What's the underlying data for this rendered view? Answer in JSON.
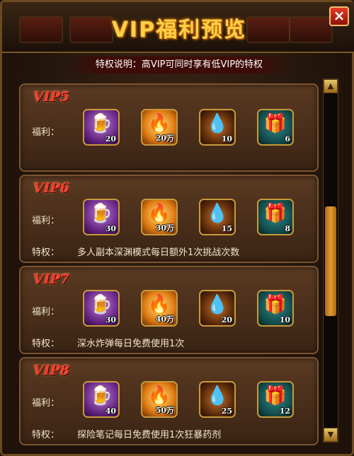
{
  "window": {
    "title": "VIP福利预览",
    "close_label": "×",
    "notice": "特权说明：高VIP可同时享有低VIP的特权"
  },
  "labels": {
    "benefit": "福利：",
    "privilege": "特权："
  },
  "scrollbar": {
    "up": "▲",
    "down": "▼"
  },
  "icons": {
    "beer": "beer-bread-icon",
    "fire": "fire-icon",
    "drop": "dark-drop-icon",
    "gift": "gift-box-icon"
  },
  "tiers": [
    {
      "name": "VIP5",
      "items": [
        {
          "icon": "beer-bread-icon",
          "count": "20"
        },
        {
          "icon": "fire-icon",
          "count": "20万"
        },
        {
          "icon": "dark-drop-icon",
          "count": "10"
        },
        {
          "icon": "gift-box-icon",
          "count": "6"
        }
      ],
      "privilege": ""
    },
    {
      "name": "VIP6",
      "items": [
        {
          "icon": "beer-bread-icon",
          "count": "30"
        },
        {
          "icon": "fire-icon",
          "count": "30万"
        },
        {
          "icon": "dark-drop-icon",
          "count": "15"
        },
        {
          "icon": "gift-box-icon",
          "count": "8"
        }
      ],
      "privilege": "多人副本深渊模式每日额外1次挑战次数"
    },
    {
      "name": "VIP7",
      "items": [
        {
          "icon": "beer-bread-icon",
          "count": "30"
        },
        {
          "icon": "fire-icon",
          "count": "40万"
        },
        {
          "icon": "dark-drop-icon",
          "count": "20"
        },
        {
          "icon": "gift-box-icon",
          "count": "10"
        }
      ],
      "privilege": "深水炸弹每日免费使用1次"
    },
    {
      "name": "VIP8",
      "items": [
        {
          "icon": "beer-bread-icon",
          "count": "40"
        },
        {
          "icon": "fire-icon",
          "count": "50万"
        },
        {
          "icon": "dark-drop-icon",
          "count": "25"
        },
        {
          "icon": "gift-box-icon",
          "count": "12"
        }
      ],
      "privilege": "探险笔记每日免费使用1次狂暴药剂"
    }
  ],
  "colors": {
    "title": "#ffcf4a",
    "vip_label": "#ff3b2b",
    "panel": "#4a2f1b",
    "border": "#7d5530"
  }
}
